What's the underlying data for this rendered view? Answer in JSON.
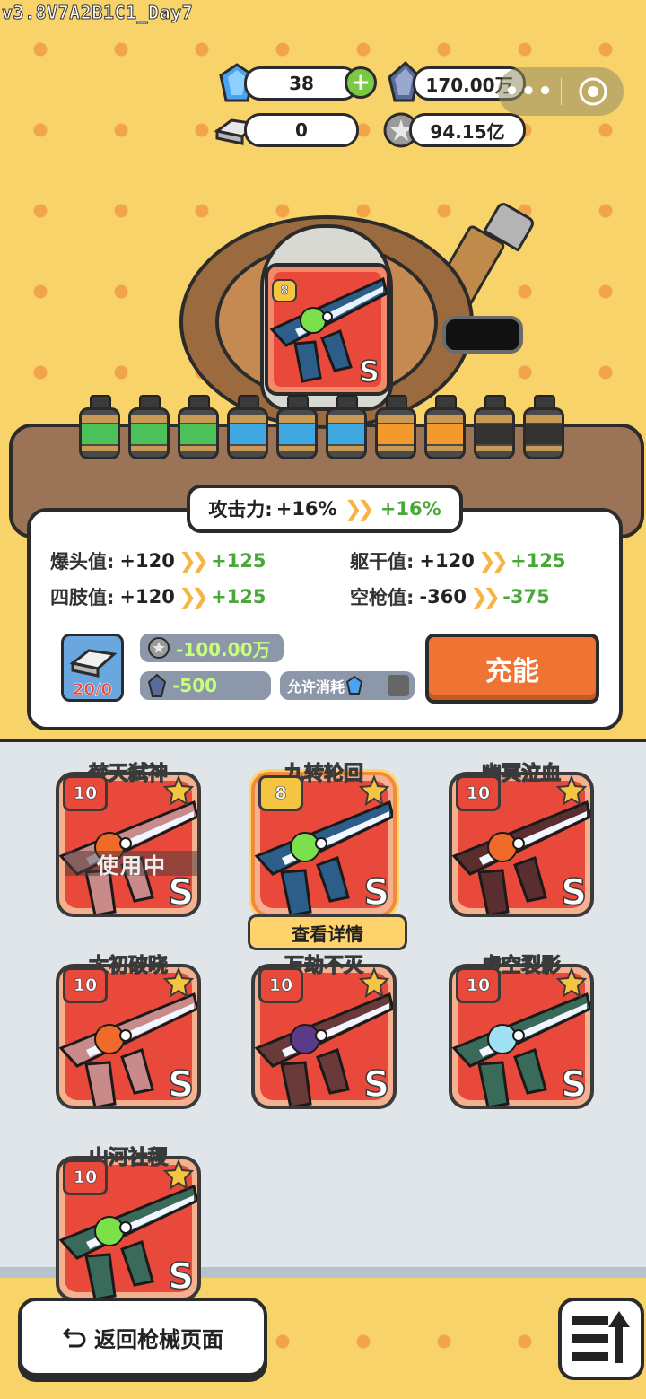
{
  "version": "v3.8V7A2B1C1_Day7",
  "currency": {
    "gems": "38",
    "dark_crystal": "170.00万",
    "silver_bars": "0",
    "coins": "94.15亿"
  },
  "featured_weapon": {
    "level": "8",
    "grade": "S"
  },
  "batteries": [
    {
      "color": "#4cc15a"
    },
    {
      "color": "#4cc15a"
    },
    {
      "color": "#4cc15a"
    },
    {
      "color": "#3fa8e0"
    },
    {
      "color": "#3fa8e0"
    },
    {
      "color": "#3fa8e0"
    },
    {
      "color": "#f29a2e"
    },
    {
      "color": "#f29a2e"
    },
    {
      "color": "#333333"
    },
    {
      "color": "#333333"
    }
  ],
  "stats": {
    "attack": {
      "label": "攻击力:",
      "current": "+16%",
      "next": "+16%"
    },
    "headshot": {
      "label": "爆头值:",
      "current": "+120",
      "next": "+125"
    },
    "torso": {
      "label": "躯干值:",
      "current": "+120",
      "next": "+125"
    },
    "limbs": {
      "label": "四肢值:",
      "current": "+120",
      "next": "+125"
    },
    "empty": {
      "label": "空枪值:",
      "current": "-360",
      "next": "-375"
    }
  },
  "cost": {
    "silver_count": "20/0",
    "coin_cost": "-100.00万",
    "crystal_cost": "-500",
    "allow_label": "允许消耗",
    "charge_label": "充能"
  },
  "weapons": [
    {
      "name": "焚天弑神",
      "level": "10",
      "grade": "S",
      "status": "使用中",
      "core": "#f06a2a",
      "body": "#c98a8a"
    },
    {
      "name": "九转轮回",
      "level": "8",
      "grade": "S",
      "core": "#7be04a",
      "body": "#2d5e8a"
    },
    {
      "name": "幽冥泣血",
      "level": "10",
      "grade": "S",
      "core": "#f06a2a",
      "body": "#5a2e2e"
    },
    {
      "name": "太初破晓",
      "level": "10",
      "grade": "S",
      "core": "#f06a2a",
      "body": "#c98a8a"
    },
    {
      "name": "万劫不灭",
      "level": "10",
      "grade": "S",
      "core": "#5b3a8a",
      "body": "#6a3a3a"
    },
    {
      "name": "虚空裂影",
      "level": "10",
      "grade": "S",
      "core": "#9fe0f5",
      "body": "#3a6a5a"
    },
    {
      "name": "山河社稷",
      "level": "10",
      "grade": "S",
      "core": "#7be04a",
      "body": "#3a6a5a"
    }
  ],
  "detail_button": "查看详情",
  "back_button": "返回枪械页面"
}
